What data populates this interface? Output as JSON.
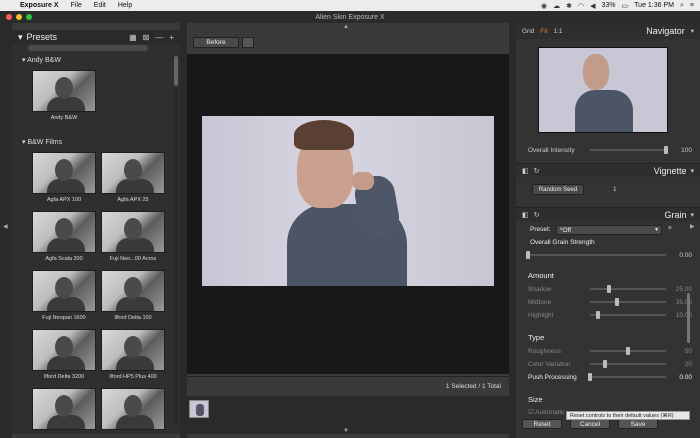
{
  "menubar": {
    "app_name": "Exposure X",
    "items": [
      "File",
      "Edit",
      "Help"
    ],
    "battery": "33%",
    "clock": "Tue 1:36 PM"
  },
  "window": {
    "title": "Alien Skin Exposure X"
  },
  "presets": {
    "title": "Presets",
    "groups": [
      {
        "label": "Andy B&W",
        "tiles": [
          "Andy B&W"
        ]
      },
      {
        "label": "B&W Films",
        "tiles": [
          "Agfa APX 100",
          "Agfa APX 25",
          "Agfa Scala 200",
          "Fuji Neo...00 Acros",
          "Fuji Neopan 1600",
          "Ilford Delta 100",
          "Ilford Delta 3200",
          "Ilford HP5 Plus 400"
        ]
      }
    ]
  },
  "center": {
    "before_label": "Before",
    "selection_count": "1 Selected / 1 Total"
  },
  "navigator": {
    "tab_grid": "Grid",
    "tab_fit": "Fit",
    "tab_1to1": "1:1",
    "title": "Navigator",
    "overall_intensity_label": "Overall Intensity",
    "overall_intensity_value": "100",
    "overall_intensity_fraction": 1.0
  },
  "vignette": {
    "title": "Vignette",
    "random_seed_label": "Random Seed",
    "random_seed_value": "1"
  },
  "grain": {
    "title": "Grain",
    "preset_label": "Preset:",
    "preset_value": "*Off",
    "overall_strength_label": "Overall Grain Strength",
    "overall_strength_value": "0.00",
    "overall_strength_fraction": 0.0,
    "amount_heading": "Amount",
    "shadow_label": "Shadow",
    "shadow_value": "25.00",
    "shadow_fraction": 0.25,
    "midtone_label": "Midtone",
    "midtone_value": "35.00",
    "midtone_fraction": 0.35,
    "highlight_label": "Highlight",
    "highlight_value": "10.00",
    "highlight_fraction": 0.1,
    "type_heading": "Type",
    "roughness_label": "Roughness",
    "roughness_value": "50",
    "roughness_fraction": 0.5,
    "color_variation_label": "Color Variation",
    "color_variation_value": "20",
    "color_variation_fraction": 0.2,
    "push_processing_label": "Push Processing",
    "push_processing_value": "0.00",
    "push_processing_fraction": 0.0,
    "size_heading": "Size",
    "automatic_label": "Automatic"
  },
  "footer": {
    "reset_label": "Reset",
    "cancel_label": "Cancel",
    "save_label": "Save",
    "tooltip": "Reset controls to their default values (⌘R)"
  }
}
